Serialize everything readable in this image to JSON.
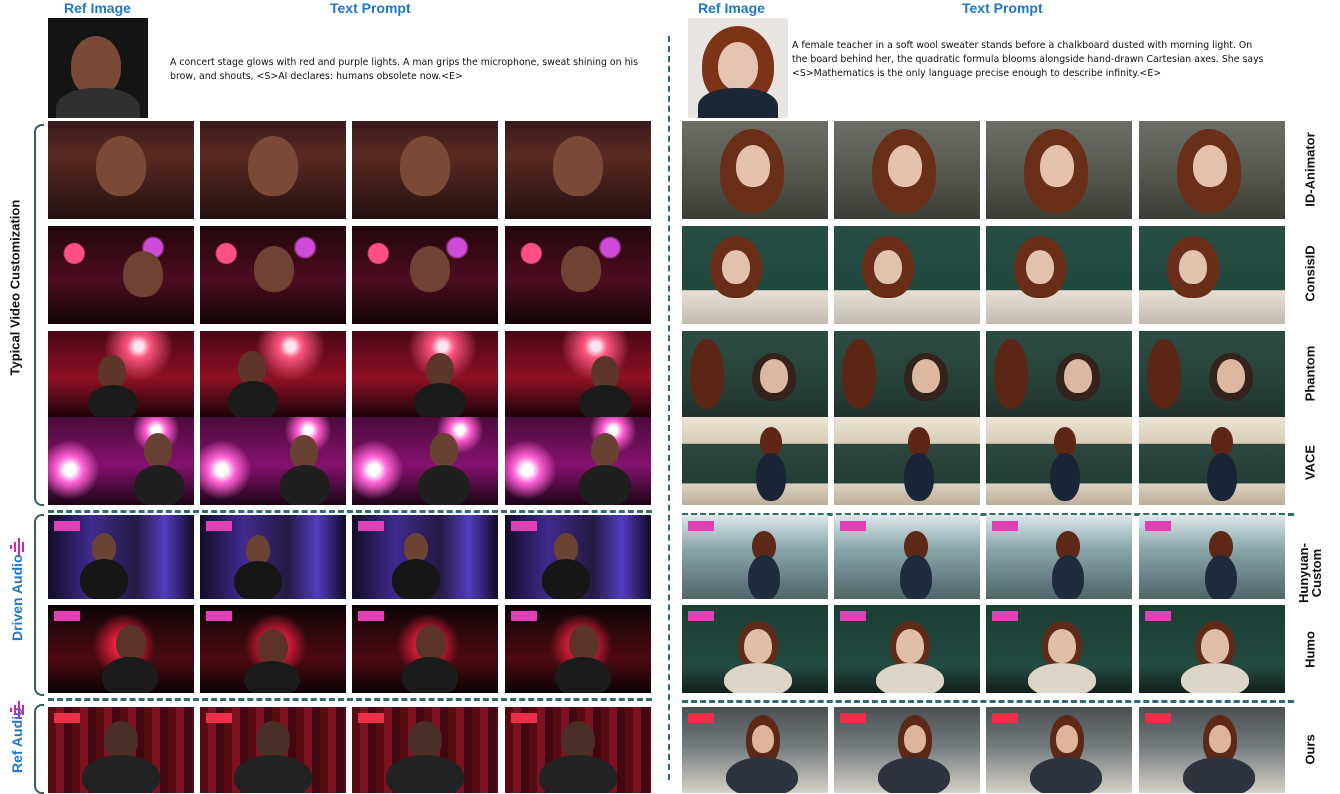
{
  "headers": {
    "left_ref": "Ref Image",
    "left_prompt": "Text Prompt",
    "right_ref": "Ref Image",
    "right_prompt": "Text Prompt"
  },
  "prompts": {
    "left": "A concert stage glows with red and purple lights. A man grips the microphone, sweat shining on his brow, and shouts, <S>AI declares: humans obsolete now.<E>",
    "right": "A female teacher in a soft wool sweater stands before a chalkboard dusted with morning light. On the board behind her, the quadratic formula blooms alongside hand-drawn Cartesian axes. She says <S>Mathematics is the only language precise enough to describe infinity.<E>"
  },
  "left_groups": {
    "typical": "Typical Video Customization",
    "driven": "Driven Audio",
    "ref": "Ref Audio"
  },
  "methods": [
    {
      "label": "ID-Animator"
    },
    {
      "label": "ConsisID"
    },
    {
      "label": "Phantom"
    },
    {
      "label": "VACE"
    },
    {
      "label": "Hunyuan-\nCustom"
    },
    {
      "label": "Humo"
    },
    {
      "label": "Ours"
    }
  ],
  "colors": {
    "header": "#1f77c9",
    "dashes": "#2e6c78"
  }
}
